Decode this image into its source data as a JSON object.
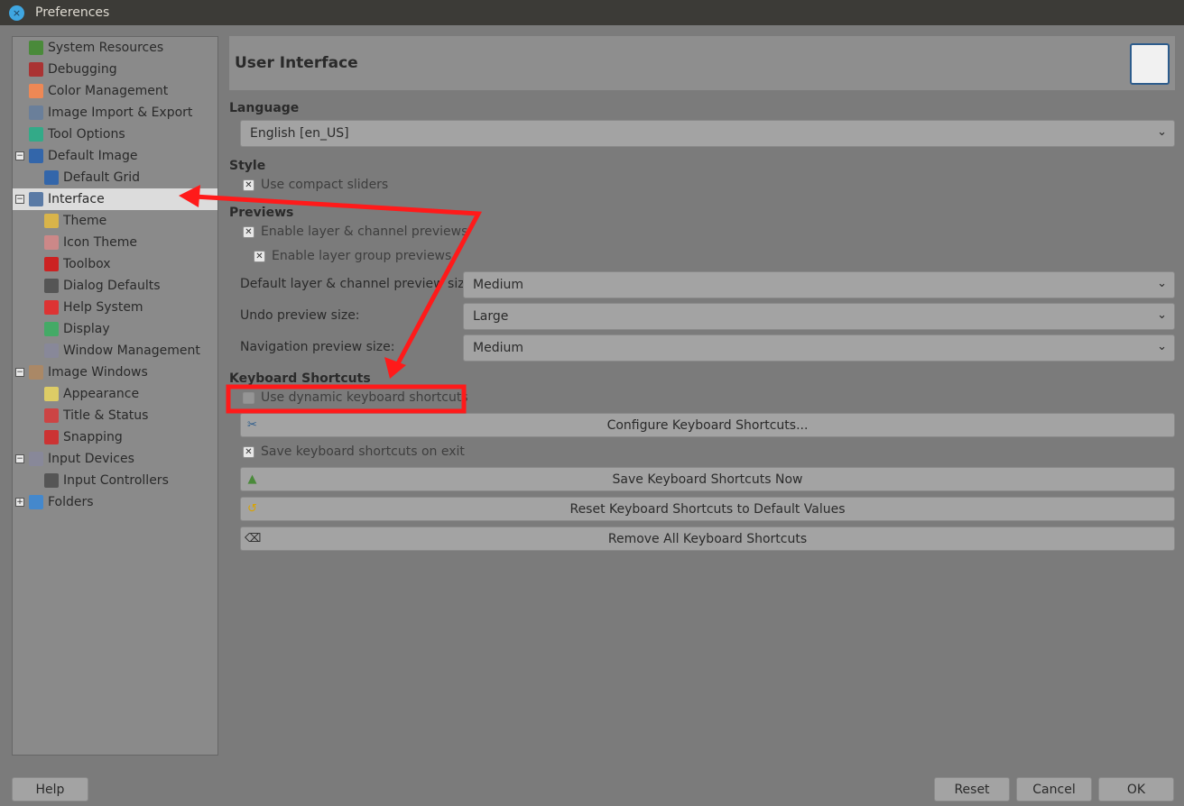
{
  "window": {
    "title": "Preferences"
  },
  "sidebar": {
    "items": [
      {
        "label": "System Resources",
        "icon": "system-resources-icon",
        "level": 0
      },
      {
        "label": "Debugging",
        "icon": "debugging-icon",
        "level": 0
      },
      {
        "label": "Color Management",
        "icon": "color-management-icon",
        "level": 0
      },
      {
        "label": "Image Import & Export",
        "icon": "image-import-export-icon",
        "level": 0
      },
      {
        "label": "Tool Options",
        "icon": "tool-options-icon",
        "level": 0
      },
      {
        "label": "Default Image",
        "icon": "default-image-icon",
        "level": 0,
        "expander": "−"
      },
      {
        "label": "Default Grid",
        "icon": "default-grid-icon",
        "level": 1
      },
      {
        "label": "Interface",
        "icon": "interface-icon",
        "level": 0,
        "expander": "−",
        "selected": true
      },
      {
        "label": "Theme",
        "icon": "theme-icon",
        "level": 1
      },
      {
        "label": "Icon Theme",
        "icon": "icon-theme-icon",
        "level": 1
      },
      {
        "label": "Toolbox",
        "icon": "toolbox-icon",
        "level": 1
      },
      {
        "label": "Dialog Defaults",
        "icon": "dialog-defaults-icon",
        "level": 1
      },
      {
        "label": "Help System",
        "icon": "help-system-icon",
        "level": 1
      },
      {
        "label": "Display",
        "icon": "display-icon",
        "level": 1
      },
      {
        "label": "Window Management",
        "icon": "window-management-icon",
        "level": 1
      },
      {
        "label": "Image Windows",
        "icon": "image-windows-icon",
        "level": 0,
        "expander": "−"
      },
      {
        "label": "Appearance",
        "icon": "appearance-icon",
        "level": 1
      },
      {
        "label": "Title & Status",
        "icon": "title-status-icon",
        "level": 1
      },
      {
        "label": "Snapping",
        "icon": "snapping-icon",
        "level": 1
      },
      {
        "label": "Input Devices",
        "icon": "input-devices-icon",
        "level": 0,
        "expander": "−"
      },
      {
        "label": "Input Controllers",
        "icon": "input-controllers-icon",
        "level": 1
      },
      {
        "label": "Folders",
        "icon": "folders-icon",
        "level": 0,
        "expander": "+"
      }
    ]
  },
  "main": {
    "title": "User Interface",
    "language": {
      "heading": "Language",
      "value": "English [en_US]"
    },
    "style": {
      "heading": "Style",
      "compact_sliders": {
        "label": "Use compact sliders",
        "checked": true
      }
    },
    "previews": {
      "heading": "Previews",
      "layer_channel": {
        "label": "Enable layer & channel previews",
        "checked": true
      },
      "layer_group": {
        "label": "Enable layer group previews",
        "checked": true
      },
      "default_size_label": "Default layer & channel preview size:",
      "default_size_value": "Medium",
      "undo_size_label": "Undo preview size:",
      "undo_size_value": "Large",
      "nav_size_label": "Navigation preview size:",
      "nav_size_value": "Medium"
    },
    "shortcuts": {
      "heading": "Keyboard Shortcuts",
      "dynamic": {
        "label": "Use dynamic keyboard shortcuts",
        "checked": false
      },
      "configure": "Configure Keyboard Shortcuts...",
      "save_on_exit": {
        "label": "Save keyboard shortcuts on exit",
        "checked": true
      },
      "save_now": "Save Keyboard Shortcuts Now",
      "reset": "Reset Keyboard Shortcuts to Default Values",
      "remove": "Remove All Keyboard Shortcuts"
    }
  },
  "footer": {
    "help": "Help",
    "reset": "Reset",
    "cancel": "Cancel",
    "ok": "OK"
  },
  "colors": {
    "annotation": "#ff1a1a",
    "selection": "#dcdcdc"
  }
}
